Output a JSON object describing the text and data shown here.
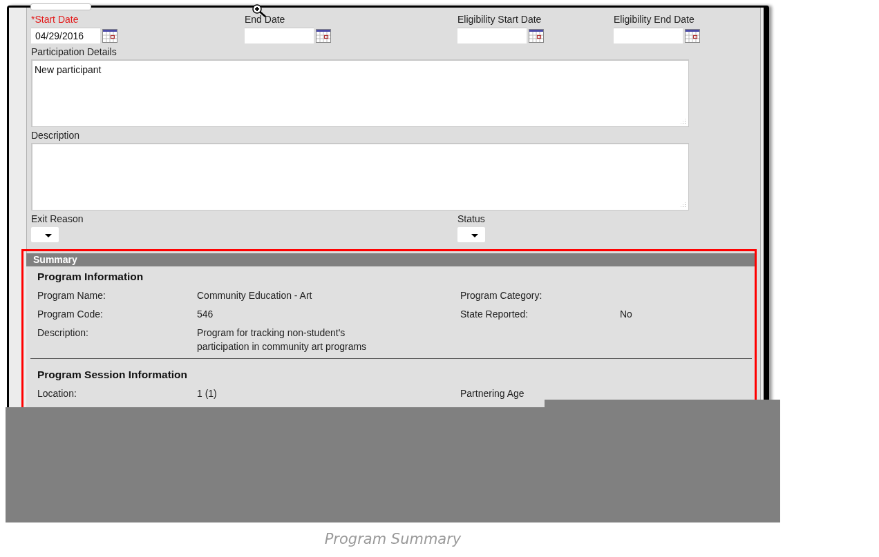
{
  "date_fields": [
    {
      "label": "*Start Date",
      "required": true,
      "value": "04/29/2016"
    },
    {
      "label": "End Date",
      "required": false
    },
    {
      "label": "Eligibility Start Date",
      "required": false
    },
    {
      "label": "Eligibility End Date",
      "required": false
    }
  ],
  "text_areas": [
    {
      "label": "Participation Details",
      "value": "New participant"
    },
    {
      "label": "Description"
    }
  ],
  "dropdowns": [
    {
      "label": "Exit Reason"
    },
    {
      "label": "Status"
    }
  ],
  "summary": {
    "title": "Summary",
    "sections": [
      {
        "title": "Program Information",
        "rows": [
          {
            "label": "Program Name:",
            "value": "Community Education - Art",
            "label_2": "Program Category:"
          },
          {
            "label": "Program Code:",
            "value": "546",
            "label_2": "State Reported:",
            "value_2": "No"
          },
          {
            "label": "Description:",
            "value": "Program for tracking non-student's participation in community art programs"
          }
        ]
      },
      {
        "title": "Program Session Information",
        "rows": [
          {
            "label": "Location:",
            "value": "1 (1)",
            "label_2": "Partnering Age"
          }
        ]
      }
    ]
  },
  "caption": "Program Summary"
}
